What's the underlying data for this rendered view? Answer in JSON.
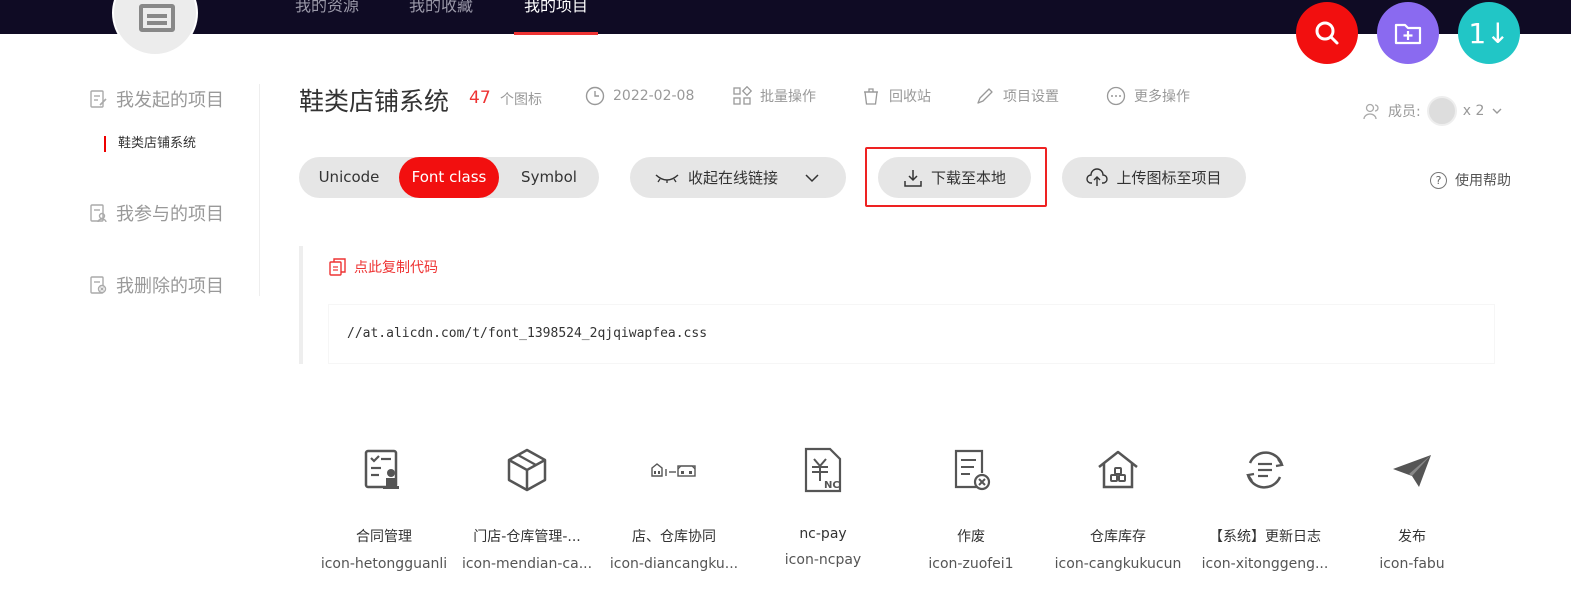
{
  "nav": {
    "tabs": [
      "我的资源",
      "我的收藏",
      "我的项目"
    ],
    "active_tab": "我的项目"
  },
  "fabs": {
    "search_icon": "search-icon",
    "folder_icon": "folder-add-icon",
    "sort_label": "1↓"
  },
  "sidebar": {
    "created": "我发起的项目",
    "current_project": "鞋类店铺系统",
    "joined": "我参与的项目",
    "deleted": "我删除的项目"
  },
  "header": {
    "title": "鞋类店铺系统",
    "icon_count": "47",
    "icon_unit": "个图标",
    "date": "2022-02-08",
    "batch": "批量操作",
    "trash": "回收站",
    "settings": "项目设置",
    "more": "更多操作",
    "members_label": "成员:",
    "members_count": "x 2"
  },
  "toolbar": {
    "formats": [
      "Unicode",
      "Font class",
      "Symbol"
    ],
    "active_format": "Font class",
    "collapse_link": "收起在线链接",
    "download": "下载至本地",
    "upload": "上传图标至项目",
    "help": "使用帮助"
  },
  "code": {
    "copy_label": "点此复制代码",
    "url": "//at.alicdn.com/t/font_1398524_2qjqiwapfea.css"
  },
  "icons": [
    {
      "name": "合同管理",
      "class": "icon-hetongguanli",
      "icon": "contract-icon"
    },
    {
      "name": "门店-仓库管理-...",
      "class": "icon-mendian-ca...",
      "icon": "box-icon"
    },
    {
      "name": "店、仓库协同",
      "class": "icon-diancangku...",
      "icon": "store-warehouse-icon"
    },
    {
      "name": "nc-pay",
      "class": "icon-ncpay",
      "icon": "invoice-yen-icon"
    },
    {
      "name": "作废",
      "class": "icon-zuofei1",
      "icon": "void-document-icon"
    },
    {
      "name": "仓库库存",
      "class": "icon-cangkukucun",
      "icon": "warehouse-icon"
    },
    {
      "name": "【系统】更新日志",
      "class": "icon-xitonggeng...",
      "icon": "update-log-icon"
    },
    {
      "name": "发布",
      "class": "icon-fabu",
      "icon": "paper-plane-icon"
    }
  ],
  "colors": {
    "accent": "#f20f0f",
    "nav_bg": "#0f0b24",
    "purple": "#8a6af0",
    "teal": "#21c6c6"
  }
}
